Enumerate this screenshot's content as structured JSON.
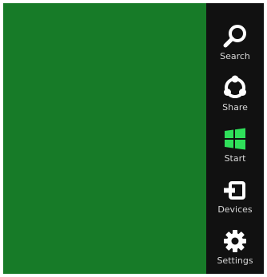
{
  "start_screen": {
    "background_color": "#177b28"
  },
  "charms": [
    {
      "label": "Search",
      "icon": "search-icon"
    },
    {
      "label": "Share",
      "icon": "share-icon"
    },
    {
      "label": "Start",
      "icon": "windows-logo-icon",
      "color": "#2fe05a"
    },
    {
      "label": "Devices",
      "icon": "devices-icon"
    },
    {
      "label": "Settings",
      "icon": "gear-icon"
    }
  ]
}
